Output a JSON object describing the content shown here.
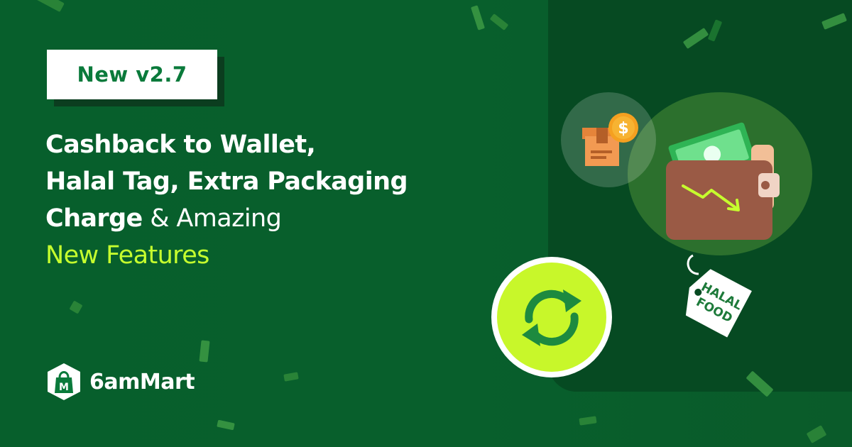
{
  "badge": {
    "label": "New v2.7"
  },
  "headline": {
    "line1": "Cashback to Wallet,",
    "line2": "Halal Tag, Extra Packaging",
    "line3_bold": "Charge",
    "line3_rest": " & Amazing",
    "line4": "New Features"
  },
  "brand": {
    "name": "6amMart",
    "logo_letter": "M"
  },
  "halal_tag": {
    "line1": "HALAL",
    "line2": "FOOD"
  },
  "box_icon": {
    "currency_symbol": "$"
  },
  "colors": {
    "background": "#075f2b",
    "accent": "#c6ff2e",
    "badge_text": "#0a7a3b",
    "panel": "#064a22",
    "wallet": "#9a5a45",
    "sync_circle": "#c8f72a"
  },
  "icons": [
    "shopping-bag-icon",
    "box-icon",
    "dollar-coin-icon",
    "wallet-icon",
    "cash-icon",
    "trend-down-arrow-icon",
    "sync-icon",
    "halal-tag-icon"
  ]
}
